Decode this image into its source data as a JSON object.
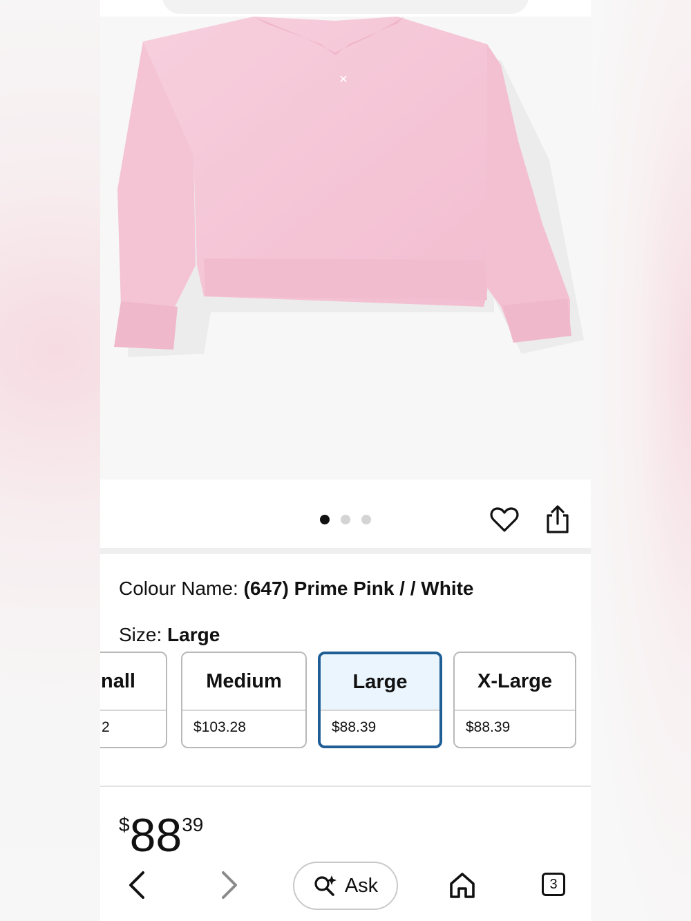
{
  "product": {
    "image_alt": "Pink hoodie",
    "colour_label": "Colour Name: ",
    "colour_value": "(647) Prime Pink / / White",
    "size_label": "Size: ",
    "size_value": "Large"
  },
  "gallery": {
    "dots_total": 3,
    "active_index": 0
  },
  "sizes": [
    {
      "name": "nall",
      "price": "2"
    },
    {
      "name": "Medium",
      "price": "$103.28"
    },
    {
      "name": "Large",
      "price": "$88.39",
      "selected": true
    },
    {
      "name": "X-Large",
      "price": "$88.39"
    }
  ],
  "price": {
    "currency": "$",
    "whole": "88",
    "fraction": "39"
  },
  "bottom_nav": {
    "ask_label": "Ask",
    "tab_count": "3"
  },
  "colors": {
    "selected_border": "#1f5e95",
    "hoodie": "#f5c6d6"
  }
}
